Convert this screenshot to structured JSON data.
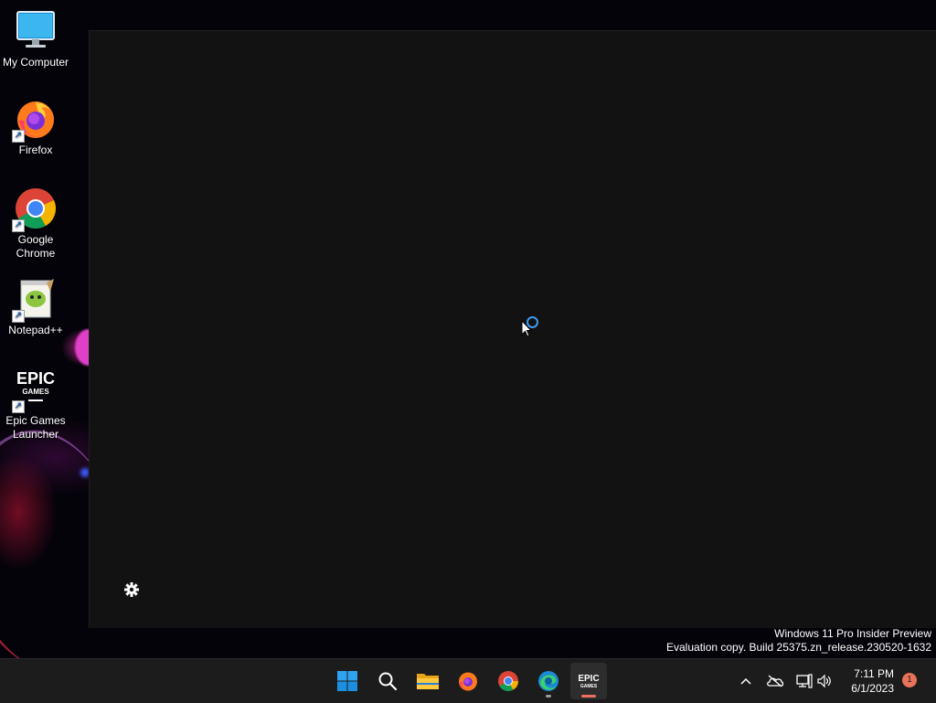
{
  "desktop": {
    "icons": [
      {
        "label": "My Computer",
        "icon": "monitor-icon"
      },
      {
        "label": "Firefox",
        "icon": "firefox-icon"
      },
      {
        "label": "Google Chrome",
        "icon": "chrome-icon"
      },
      {
        "label": "Notepad++",
        "icon": "notepadpp-icon"
      },
      {
        "label": "Epic Games Launcher",
        "icon": "epic-games-icon"
      }
    ],
    "epic_logo_text_1": "EPIC",
    "epic_logo_text_2": "GAMES"
  },
  "app_window": {
    "state": "loading",
    "settings_icon": "gear-icon"
  },
  "watermark": {
    "line1": "Windows 11 Pro Insider Preview",
    "line2": "Evaluation copy. Build 25375.zn_release.230520-1632"
  },
  "taskbar": {
    "apps": [
      {
        "name": "Start",
        "icon": "windows-start-icon"
      },
      {
        "name": "Search",
        "icon": "search-icon"
      },
      {
        "name": "File Explorer",
        "icon": "folder-icon"
      },
      {
        "name": "Firefox",
        "icon": "firefox-icon"
      },
      {
        "name": "Google Chrome",
        "icon": "chrome-icon"
      },
      {
        "name": "Microsoft Edge",
        "icon": "edge-icon"
      },
      {
        "name": "Epic Games Launcher",
        "icon": "epic-games-icon",
        "active": true
      }
    ],
    "tray": {
      "chevron": "^",
      "time": "7:11 PM",
      "date": "6/1/2023",
      "notification_count": "1"
    }
  },
  "colors": {
    "accent": "#3a9bf0",
    "taskbar": "#1c1c1c",
    "window_bg": "#121212",
    "active_indicator": "#f07060"
  }
}
